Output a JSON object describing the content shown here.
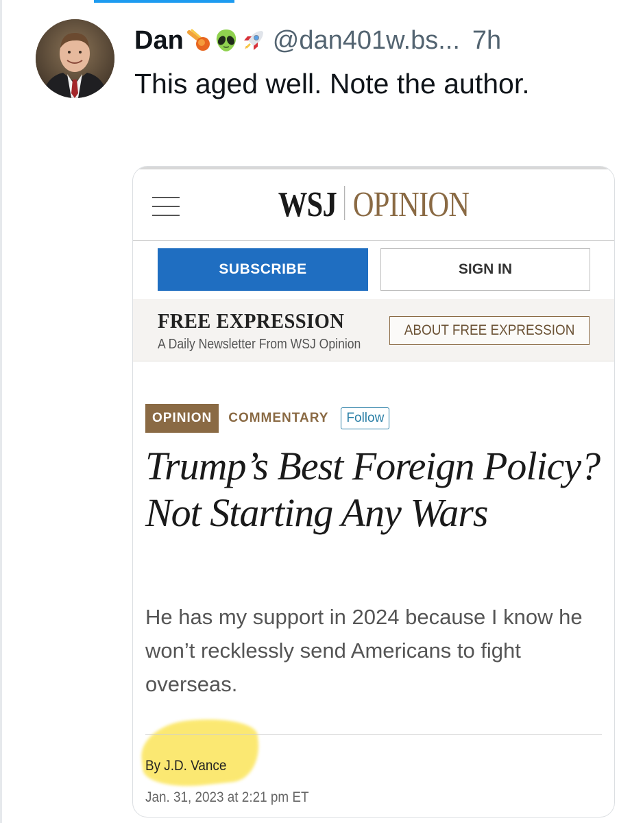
{
  "post": {
    "author_name": "Dan",
    "emojis": [
      "comet-emoji",
      "alien-emoji",
      "rocket-emoji"
    ],
    "handle": "@dan401w.bs...",
    "time": "7h",
    "text": "This aged well. Note the author."
  },
  "wsj": {
    "brand_left": "WSJ",
    "brand_right": "OPINION",
    "subscribe_label": "SUBSCRIBE",
    "signin_label": "SIGN IN",
    "newsletter_title": "FREE EXPRESSION",
    "newsletter_subtitle": "A Daily Newsletter From WSJ Opinion",
    "about_label": "ABOUT FREE EXPRESSION",
    "tag_opinion": "OPINION",
    "tag_commentary": "COMMENTARY",
    "follow_label": "Follow",
    "headline": "Trump’s Best Foreign Policy? Not Starting Any Wars",
    "dek": "He has my support in 2024 because I know he won’t recklessly send Americans to fight overseas.",
    "byline": "By J.D. Vance",
    "timestamp": "Jan. 31, 2023 at 2:21 pm ET"
  },
  "colors": {
    "accent_blue": "#1d9bf0",
    "subscribe_blue": "#1f6ec1",
    "opinion_brown": "#8a6a44",
    "follow_blue": "#2a7fa6",
    "highlight_yellow": "#fbe55a"
  }
}
